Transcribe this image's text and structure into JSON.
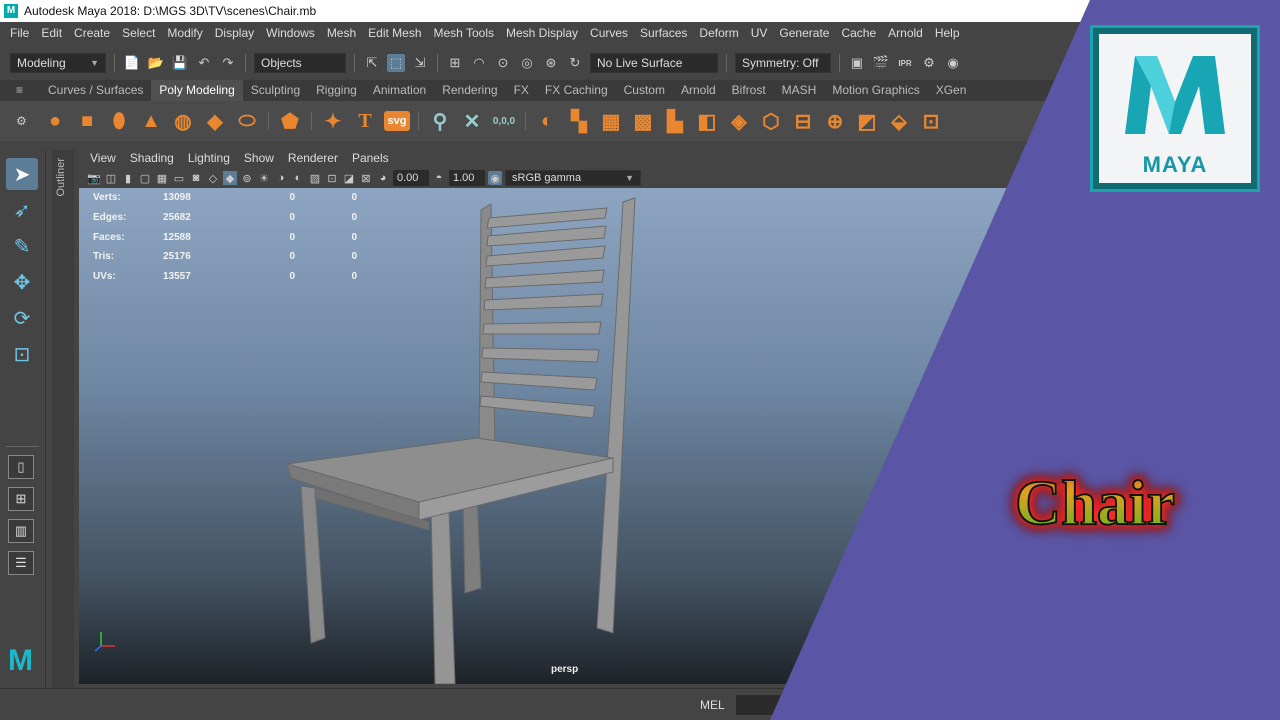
{
  "window": {
    "title": "Autodesk Maya 2018: D:\\MGS 3D\\TV\\scenes\\Chair.mb",
    "maximized_hint": "W"
  },
  "menu": [
    "File",
    "Edit",
    "Create",
    "Select",
    "Modify",
    "Display",
    "Windows",
    "Mesh",
    "Edit Mesh",
    "Mesh Tools",
    "Mesh Display",
    "Curves",
    "Surfaces",
    "Deform",
    "UV",
    "Generate",
    "Cache",
    "Arnold",
    "Help"
  ],
  "status_line": {
    "menu_set": "Modeling",
    "selection_mode": "Objects",
    "live_surface": "No Live Surface",
    "symmetry": "Symmetry: Off",
    "ipr": "IPR"
  },
  "shelf": {
    "tabs": [
      "Curves / Surfaces",
      "Poly Modeling",
      "Sculpting",
      "Rigging",
      "Animation",
      "Rendering",
      "FX",
      "FX Caching",
      "Custom",
      "Arnold",
      "Bifrost",
      "MASH",
      "Motion Graphics",
      "XGen"
    ],
    "active_tab": "Poly Modeling",
    "icons": [
      "poly-sphere",
      "poly-cube",
      "poly-cylinder",
      "poly-cone",
      "poly-torus",
      "poly-plane",
      "poly-disc",
      "platonic-solid",
      "super-shape",
      "type",
      "svg",
      "sculpt",
      "uv-unfold",
      "combine",
      "separate",
      "smooth",
      "bridge",
      "extrude",
      "bevel",
      "append",
      "multicut",
      "target-weld",
      "mirror",
      "circularize",
      "quad-draw"
    ],
    "svg_label": "svg",
    "numeric_label": "0,0,0"
  },
  "toolbox": {
    "tools": [
      "select-tool",
      "lasso-tool",
      "paint-select-tool",
      "move-tool",
      "rotate-tool",
      "scale-tool"
    ],
    "active": "select-tool"
  },
  "outliner_label": "Outliner",
  "panel": {
    "menu": [
      "View",
      "Shading",
      "Lighting",
      "Show",
      "Renderer",
      "Panels"
    ],
    "exposure": "0.00",
    "gamma": "1.00",
    "color_space": "sRGB gamma"
  },
  "hud": {
    "rows": [
      {
        "label": "Verts:",
        "total": "13098",
        "selected": "0",
        "component": "0"
      },
      {
        "label": "Edges:",
        "total": "25682",
        "selected": "0",
        "component": "0"
      },
      {
        "label": "Faces:",
        "total": "12588",
        "selected": "0",
        "component": "0"
      },
      {
        "label": "Tris:",
        "total": "25176",
        "selected": "0",
        "component": "0"
      },
      {
        "label": "UVs:",
        "total": "13557",
        "selected": "0",
        "component": "0"
      }
    ]
  },
  "camera_label": "persp",
  "command_line": {
    "language": "MEL"
  },
  "overlay": {
    "logo_text": "MAYA",
    "title_text": "Chair",
    "bg_color": "#5a55a5"
  }
}
